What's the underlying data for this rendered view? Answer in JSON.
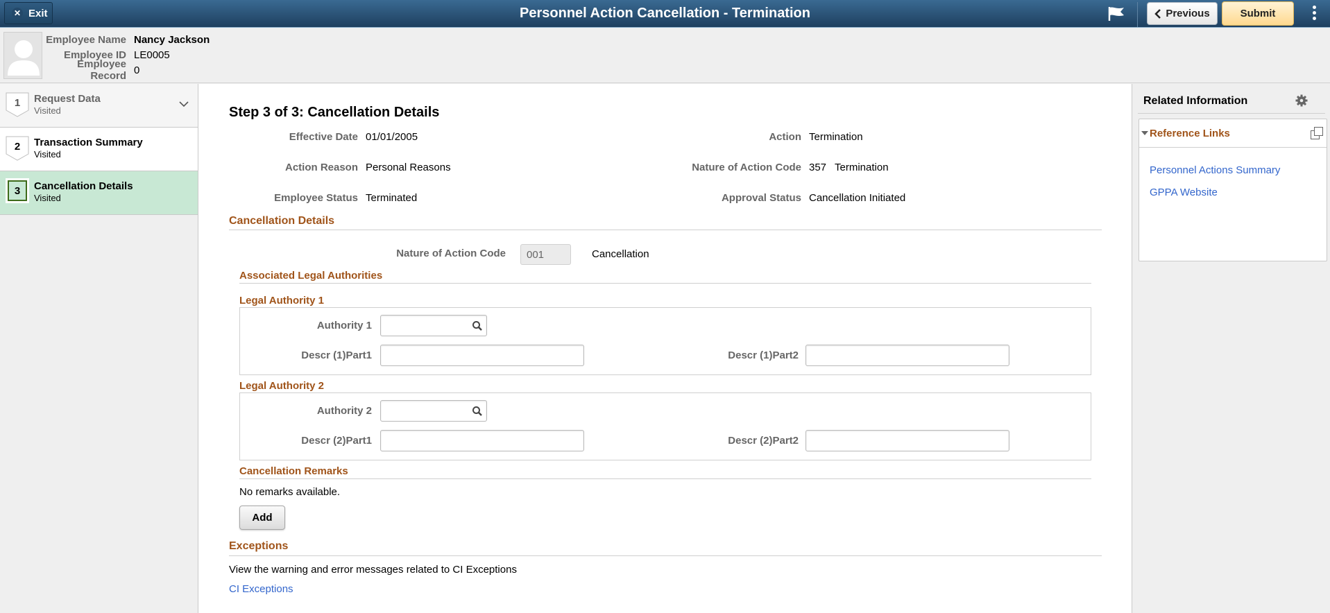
{
  "titlebar": {
    "exit_label": "Exit",
    "title": "Personnel Action Cancellation - Termination",
    "previous_label": "Previous",
    "submit_label": "Submit"
  },
  "employee": {
    "name_label": "Employee Name",
    "name": "Nancy Jackson",
    "id_label": "Employee ID",
    "id": "LE0005",
    "record_label": "Employee Record",
    "record": "0"
  },
  "steps": [
    {
      "number": "1",
      "title": "Request Data",
      "status": "Visited"
    },
    {
      "number": "2",
      "title": "Transaction Summary",
      "status": "Visited"
    },
    {
      "number": "3",
      "title": "Cancellation Details",
      "status": "Visited"
    }
  ],
  "main": {
    "heading": "Step 3 of 3: Cancellation Details",
    "summary": {
      "effective_date_label": "Effective Date",
      "effective_date": "01/01/2005",
      "action_reason_label": "Action Reason",
      "action_reason": "Personal Reasons",
      "employee_status_label": "Employee Status",
      "employee_status": "Terminated",
      "action_label": "Action",
      "action": "Termination",
      "noa_label": "Nature of Action Code",
      "noa_code": "357",
      "noa_descr": "Termination",
      "approval_status_label": "Approval Status",
      "approval_status": "Cancellation Initiated"
    },
    "cancellation": {
      "section_title": "Cancellation Details",
      "noa_label": "Nature of Action Code",
      "noa_code": "001",
      "noa_descr": "Cancellation",
      "legal_authorities_title": "Associated Legal Authorities",
      "la1": {
        "title": "Legal Authority 1",
        "authority_label": "Authority 1",
        "authority_value": "",
        "descr_part1_label": "Descr (1)Part1",
        "descr_part1_value": "",
        "descr_part2_label": "Descr (1)Part2",
        "descr_part2_value": ""
      },
      "la2": {
        "title": "Legal Authority 2",
        "authority_label": "Authority 2",
        "authority_value": "",
        "descr_part1_label": "Descr (2)Part1",
        "descr_part1_value": "",
        "descr_part2_label": "Descr (2)Part2",
        "descr_part2_value": ""
      },
      "remarks_title": "Cancellation Remarks",
      "remarks_text": "No remarks available.",
      "add_label": "Add"
    },
    "exceptions": {
      "title": "Exceptions",
      "description": "View the warning and error messages related to CI Exceptions",
      "link": "CI Exceptions"
    }
  },
  "related": {
    "title": "Related Information",
    "box_title": "Reference Links",
    "links": [
      "Personnel Actions Summary",
      "GPPA Website"
    ]
  },
  "colors": {
    "titlebar": "#2b5377",
    "section_title": "#a0541a",
    "link": "#3366cc",
    "active_step": "#c8e8d4",
    "submit": "#ffd98f"
  }
}
